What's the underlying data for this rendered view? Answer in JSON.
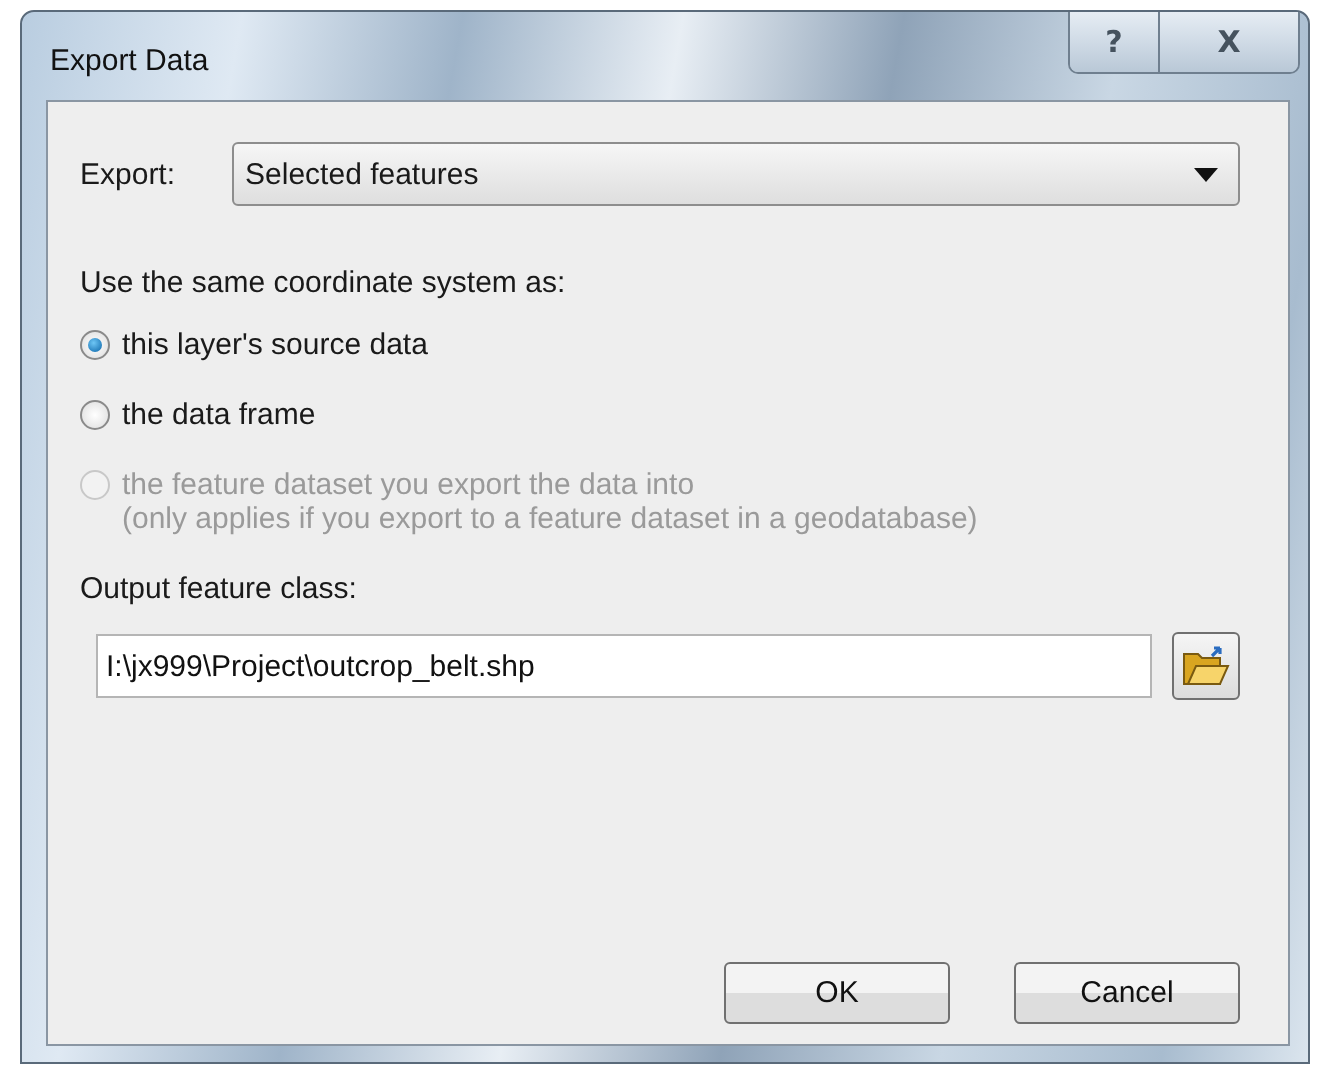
{
  "window": {
    "title": "Export Data",
    "caption_buttons": [
      {
        "kind": "help",
        "label": "?"
      },
      {
        "kind": "close",
        "label": "X"
      }
    ]
  },
  "export": {
    "label": "Export:",
    "value": "Selected features"
  },
  "coordinate_system": {
    "label": "Use the same coordinate system as:",
    "options": [
      {
        "label": "this layer's source data",
        "selected": true,
        "disabled": false
      },
      {
        "label": "the data frame",
        "selected": false,
        "disabled": false
      },
      {
        "label": "the feature dataset you export the data into",
        "note": "(only applies if you export to a feature dataset in a geodatabase)",
        "selected": false,
        "disabled": true
      }
    ]
  },
  "output": {
    "label": "Output feature class:",
    "value": "I:\\jx999\\Project\\outcrop_belt.shp"
  },
  "buttons": [
    {
      "label": "OK"
    },
    {
      "label": "Cancel"
    }
  ]
}
